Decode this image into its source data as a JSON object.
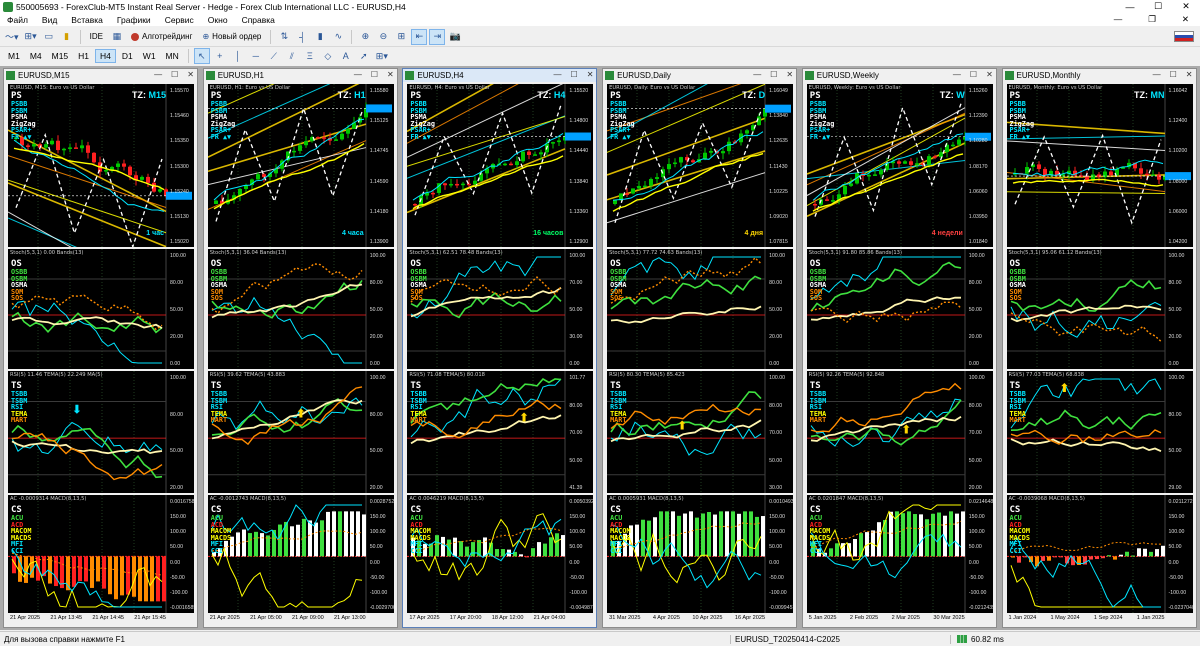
{
  "titlebar": {
    "title": "550005693 - ForexClub-MT5 Instant Real Server - Hedge - Forex Club International LLC - EURUSD,H4"
  },
  "menu": [
    "Файл",
    "Вид",
    "Вставка",
    "Графики",
    "Сервис",
    "Окно",
    "Справка"
  ],
  "toolbar": {
    "ide": "IDE",
    "algo_label": "Алготрейдинг",
    "new_order_label": "Новый ордер"
  },
  "timeframes": [
    "M1",
    "M4",
    "M15",
    "H1",
    "H4",
    "D1",
    "W1",
    "MN"
  ],
  "selected_timeframe": "H4",
  "status": {
    "help": "Для вызова справки нажмите F1",
    "profile": "EURUSD_T20250414-C2025",
    "ping": "60.82 ms"
  },
  "windows": [
    {
      "caption": "EURUSD,M15",
      "title_line": "EURUSD, M15: Euro vs US Dollar",
      "tz": "M15",
      "tf_label": "1 час",
      "tf_color": "#00e5ff",
      "price_ticks": [
        "1.15570",
        "1.15460",
        "1.15350",
        "1.15300",
        "1.15240",
        "1.15130",
        "1.15020"
      ],
      "osc_ticks": [
        "100.00",
        "80.00",
        "50.00",
        "20.00",
        "0.00"
      ],
      "ts_ticks": [
        "100.00",
        "80.00",
        "50.00",
        "20.00"
      ],
      "cs_ticks": [
        "0.0016758",
        "150.00",
        "100.00",
        "50.00",
        "0.00",
        "-50.00",
        "-100.00",
        "-0.0016585"
      ],
      "stoch_head": "Stoch(5,3,1) 0.00 Bands(13)",
      "rsi_head": "RSI(5) 11.46 TEMA(5) 22.249 MA(5)",
      "macd_head": "AC -0.0009314 MACD(8,13,5)",
      "x_labels": [
        "21 Apr 2025",
        "21 Apr 13:45",
        "21 Apr 14:45",
        "21 Apr 15:45"
      ],
      "trend": -1,
      "seed": 3
    },
    {
      "caption": "EURUSD,H1",
      "title_line": "EURUSD, H1: Euro vs US Dollar",
      "tz": "H1",
      "tf_label": "4 часа",
      "tf_color": "#00e5ff",
      "price_ticks": [
        "1.15580",
        "1.15125",
        "1.14745",
        "1.14590",
        "1.14180",
        "1.13900"
      ],
      "osc_ticks": [
        "100.00",
        "80.00",
        "50.00",
        "20.00",
        "0.00"
      ],
      "ts_ticks": [
        "100.00",
        "80.00",
        "50.00",
        "20.00"
      ],
      "cs_ticks": [
        "0.0028752",
        "150.00",
        "100.00",
        "50.00",
        "0.00",
        "-50.00",
        "-100.00",
        "-0.0029700"
      ],
      "stoch_head": "Stoch(5,3,1) 36.04 Bands(13)",
      "rsi_head": "RSI(5) 39.62 TEMA(5) 43.883",
      "macd_head": "AC -0.0012743 MACD(8,13,5)",
      "x_labels": [
        "21 Apr 2025",
        "21 Apr 05:00",
        "21 Apr 09:00",
        "21 Apr 13:00"
      ],
      "trend": 1,
      "seed": 7
    },
    {
      "caption": "EURUSD,H4",
      "title_line": "EURUSD, H4: Euro vs US Dollar",
      "tz": "H4",
      "tf_label": "16 часов",
      "tf_color": "#00ff66",
      "price_ticks": [
        "1.15520",
        "1.14800",
        "1.14440",
        "1.13840",
        "1.13360",
        "1.12900"
      ],
      "osc_ticks": [
        "100.00",
        "70.00",
        "50.00",
        "30.00",
        "0.00"
      ],
      "ts_ticks": [
        "101.77",
        "80.00",
        "70.00",
        "50.00",
        "41.39"
      ],
      "cs_ticks": [
        "0.0050392",
        "150.00",
        "100.00",
        "50.00",
        "0.00",
        "-50.00",
        "-100.00",
        "-0.0049872"
      ],
      "stoch_head": "Stoch(5,3,1) 62.51 78.48 Bands(13)",
      "rsi_head": "RSI(5) 71.08 TEMA(5) 80.018",
      "macd_head": "AC 0.0046219 MACD(8,13,5)",
      "x_labels": [
        "17 Apr 2025",
        "17 Apr 20:00",
        "18 Apr 12:00",
        "21 Apr 04:00"
      ],
      "trend": 1,
      "seed": 11
    },
    {
      "caption": "EURUSD,Daily",
      "title_line": "EURUSD, Daily: Euro vs US Dollar",
      "tz": "D",
      "tf_label": "4 дня",
      "tf_color": "#ffd700",
      "price_ticks": [
        "1.16049",
        "1.13840",
        "1.12635",
        "1.11430",
        "1.10225",
        "1.09020",
        "1.07815"
      ],
      "osc_ticks": [
        "100.00",
        "80.00",
        "50.00",
        "20.00",
        "0.00"
      ],
      "ts_ticks": [
        "100.00",
        "80.00",
        "70.00",
        "50.00",
        "30.00"
      ],
      "cs_ticks": [
        "0.0010493",
        "150.00",
        "100.00",
        "50.00",
        "0.00",
        "-50.00",
        "-100.00",
        "-0.0099457"
      ],
      "stoch_head": "Stoch(5,3,1) 77.72 74.63 Bands(13)",
      "rsi_head": "RSI(5) 80.30 TEMA(5) 85.423",
      "macd_head": "AC 0.0005931 MACD(8,13,5)",
      "x_labels": [
        "31 Mar 2025",
        "4 Apr 2025",
        "10 Apr 2025",
        "16 Apr 2025"
      ],
      "trend": 1,
      "seed": 19
    },
    {
      "caption": "EURUSD,Weekly",
      "title_line": "EURUSD, Weekly: Euro vs US Dollar",
      "tz": "W",
      "tf_label": "4 недели",
      "tf_color": "#ff4040",
      "price_ticks": [
        "1.15260",
        "1.12390",
        "1.10280",
        "1.08170",
        "1.06060",
        "1.03950",
        "1.01840"
      ],
      "osc_ticks": [
        "100.00",
        "80.00",
        "50.00",
        "20.00",
        "0.00"
      ],
      "ts_ticks": [
        "100.00",
        "80.00",
        "70.00",
        "50.00",
        "20.00"
      ],
      "cs_ticks": [
        "0.0214648",
        "150.00",
        "100.00",
        "50.00",
        "0.00",
        "-50.00",
        "-100.00",
        "-0.0212435"
      ],
      "stoch_head": "Stoch(5,3,1) 91.80 85.86 Bands(13)",
      "rsi_head": "RSI(5) 92.26 TEMA(5) 92.848",
      "macd_head": "AC 0.0201847 MACD(8,13,5)",
      "x_labels": [
        "5 Jan 2025",
        "2 Feb 2025",
        "2 Mar 2025",
        "30 Mar 2025"
      ],
      "trend": 1,
      "seed": 23
    },
    {
      "caption": "EURUSD,Monthly",
      "title_line": "EURUSD, Monthly: Euro vs US Dollar",
      "tz": "MN",
      "tf_label": "",
      "tf_color": "#ff4040",
      "price_ticks": [
        "1.16042",
        "1.12400",
        "1.10200",
        "1.08000",
        "1.06000",
        "1.04200"
      ],
      "osc_ticks": [
        "100.00",
        "80.00",
        "50.00",
        "20.00",
        "0.00"
      ],
      "ts_ticks": [
        "100.00",
        "80.00",
        "50.00",
        "29.00"
      ],
      "cs_ticks": [
        "0.0211272",
        "150.00",
        "100.00",
        "50.00",
        "0.00",
        "-50.00",
        "-100.00",
        "-0.0237040"
      ],
      "stoch_head": "Stoch(5,3,1) 95.06 61.12 Bands(13)",
      "rsi_head": "RSI(5) 77.03 TEMA(5) 68.838",
      "macd_head": "AC -0.0039068 MACD(8,13,5)",
      "x_labels": [
        "1 Jan 2024",
        "1 May 2024",
        "1 Sep 2024",
        "1 Jan 2025"
      ],
      "trend": 0,
      "seed": 31
    }
  ],
  "panel_labels": {
    "ps": [
      "PSBB",
      "PSBM",
      "PSMA",
      "ZigZag",
      "PSAR+",
      "FR ▲▼"
    ],
    "os": [
      "OSBB",
      "OSBM",
      "OSMA",
      "SOM",
      "SOS"
    ],
    "ts": [
      "TSBB",
      "TSBM",
      "RSI",
      "TEMA",
      "MART"
    ],
    "cs": [
      "ACU",
      "ACD",
      "MACOM",
      "MACDS",
      "MFI",
      "CCI"
    ]
  },
  "colors": {
    "bg": "#000000",
    "bull": "#00c800",
    "bear": "#ff2020",
    "cyan": "#00e5ff",
    "yellow": "#ffff00",
    "orange": "#ff8c00",
    "cream": "#fff5b0",
    "green": "#3fe03f",
    "red_level": "#ff2020"
  }
}
